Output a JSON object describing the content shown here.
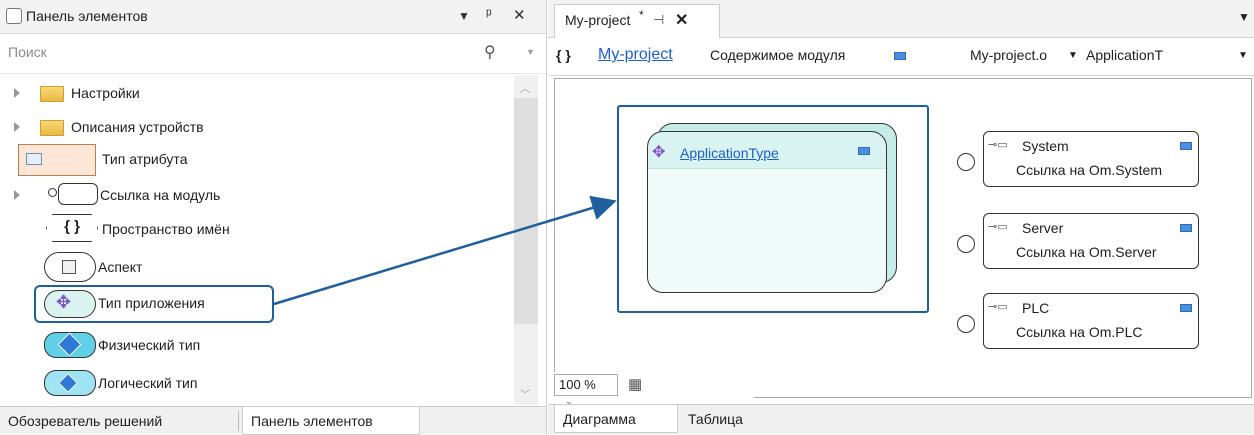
{
  "left_panel": {
    "title": "Панель элементов",
    "search_placeholder": "Поиск",
    "items": [
      {
        "label": "Настройки"
      },
      {
        "label": "Описания устройств"
      },
      {
        "label": "Тип атрибута"
      },
      {
        "label": "Ссылка на модуль"
      },
      {
        "label": "Пространство имён"
      },
      {
        "label": "Аспект"
      },
      {
        "label": "Тип приложения"
      },
      {
        "label": "Физический тип"
      },
      {
        "label": "Логический тип"
      }
    ],
    "bottom_tabs": [
      "Обозреватель решений",
      "Панель элементов"
    ]
  },
  "right_panel": {
    "tab_title": "My-project",
    "tab_modified_mark": "*",
    "breadcrumb": {
      "brace": "{ }",
      "project_link": "My-project",
      "content_label": "Содержимое модуля",
      "dropdown1": "My-project.o",
      "dropdown2": "ApplicationT"
    },
    "diagram": {
      "app_type_label": "ApplicationType",
      "refs": [
        {
          "name": "System",
          "desc": "Ссылка на Om.System"
        },
        {
          "name": "Server",
          "desc": "Ссылка на Om.Server"
        },
        {
          "name": "PLC",
          "desc": "Ссылка на Om.PLC"
        }
      ]
    },
    "zoom": "100 %",
    "bottom_tabs": [
      "Диаграмма",
      "Таблица"
    ]
  },
  "colors": {
    "selection_border": "#1f5f9e",
    "app_card_fill": "#d9f3f0",
    "link": "#1b5fd0"
  }
}
